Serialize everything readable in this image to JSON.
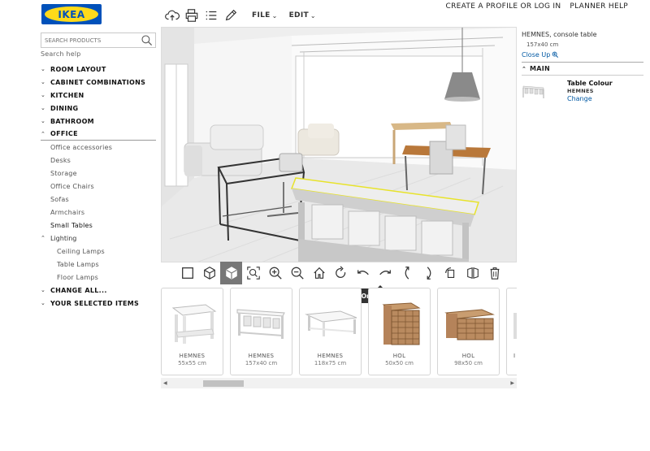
{
  "logo": {
    "text": "IKEA"
  },
  "header": {
    "menus": [
      {
        "label": "FILE"
      },
      {
        "label": "EDIT"
      }
    ],
    "links": [
      {
        "label": "CREATE A PROFILE OR LOG IN"
      },
      {
        "label": "PLANNER HELP"
      }
    ]
  },
  "sidebar": {
    "search_placeholder": "SEARCH PRODUCTS",
    "search_help": "Search help",
    "categories": [
      {
        "label": "ROOM LAYOUT"
      },
      {
        "label": "CABINET COMBINATIONS"
      },
      {
        "label": "KITCHEN"
      },
      {
        "label": "DINING"
      },
      {
        "label": "BATHROOM"
      },
      {
        "label": "OFFICE"
      }
    ],
    "office_items": [
      {
        "label": "Office accessories"
      },
      {
        "label": "Desks"
      },
      {
        "label": "Storage"
      },
      {
        "label": "Office Chairs"
      },
      {
        "label": "Sofas"
      },
      {
        "label": "Armchairs"
      },
      {
        "label": "Small Tables"
      },
      {
        "label": "Lighting"
      }
    ],
    "lighting_items": [
      {
        "label": "Ceiling Lamps"
      },
      {
        "label": "Table Lamps"
      },
      {
        "label": "Floor Lamps"
      }
    ],
    "bottom_categories": [
      {
        "label": "CHANGE ALL..."
      },
      {
        "label": "YOUR SELECTED ITEMS"
      }
    ]
  },
  "view_toolbar": {
    "tooltip": "Orbit Right"
  },
  "products": [
    {
      "name": "HEMNES",
      "size": "55x55 cm"
    },
    {
      "name": "HEMNES",
      "size": "157x40 cm"
    },
    {
      "name": "HEMNES",
      "size": "118x75 cm"
    },
    {
      "name": "HOL",
      "size": "50x50 cm"
    },
    {
      "name": "HOL",
      "size": "98x50 cm"
    },
    {
      "name": "I",
      "size": ""
    }
  ],
  "right_panel": {
    "title": "HEMNES, console table",
    "size": "157x40 cm",
    "close_up": "Close Up",
    "section": "MAIN",
    "property_label": "Table Colour",
    "property_value": "HEMNES",
    "change": "Change"
  },
  "colors": {
    "ikea_blue": "#0051ba",
    "ikea_yellow": "#ffda1a",
    "link_blue": "#0058a3"
  }
}
